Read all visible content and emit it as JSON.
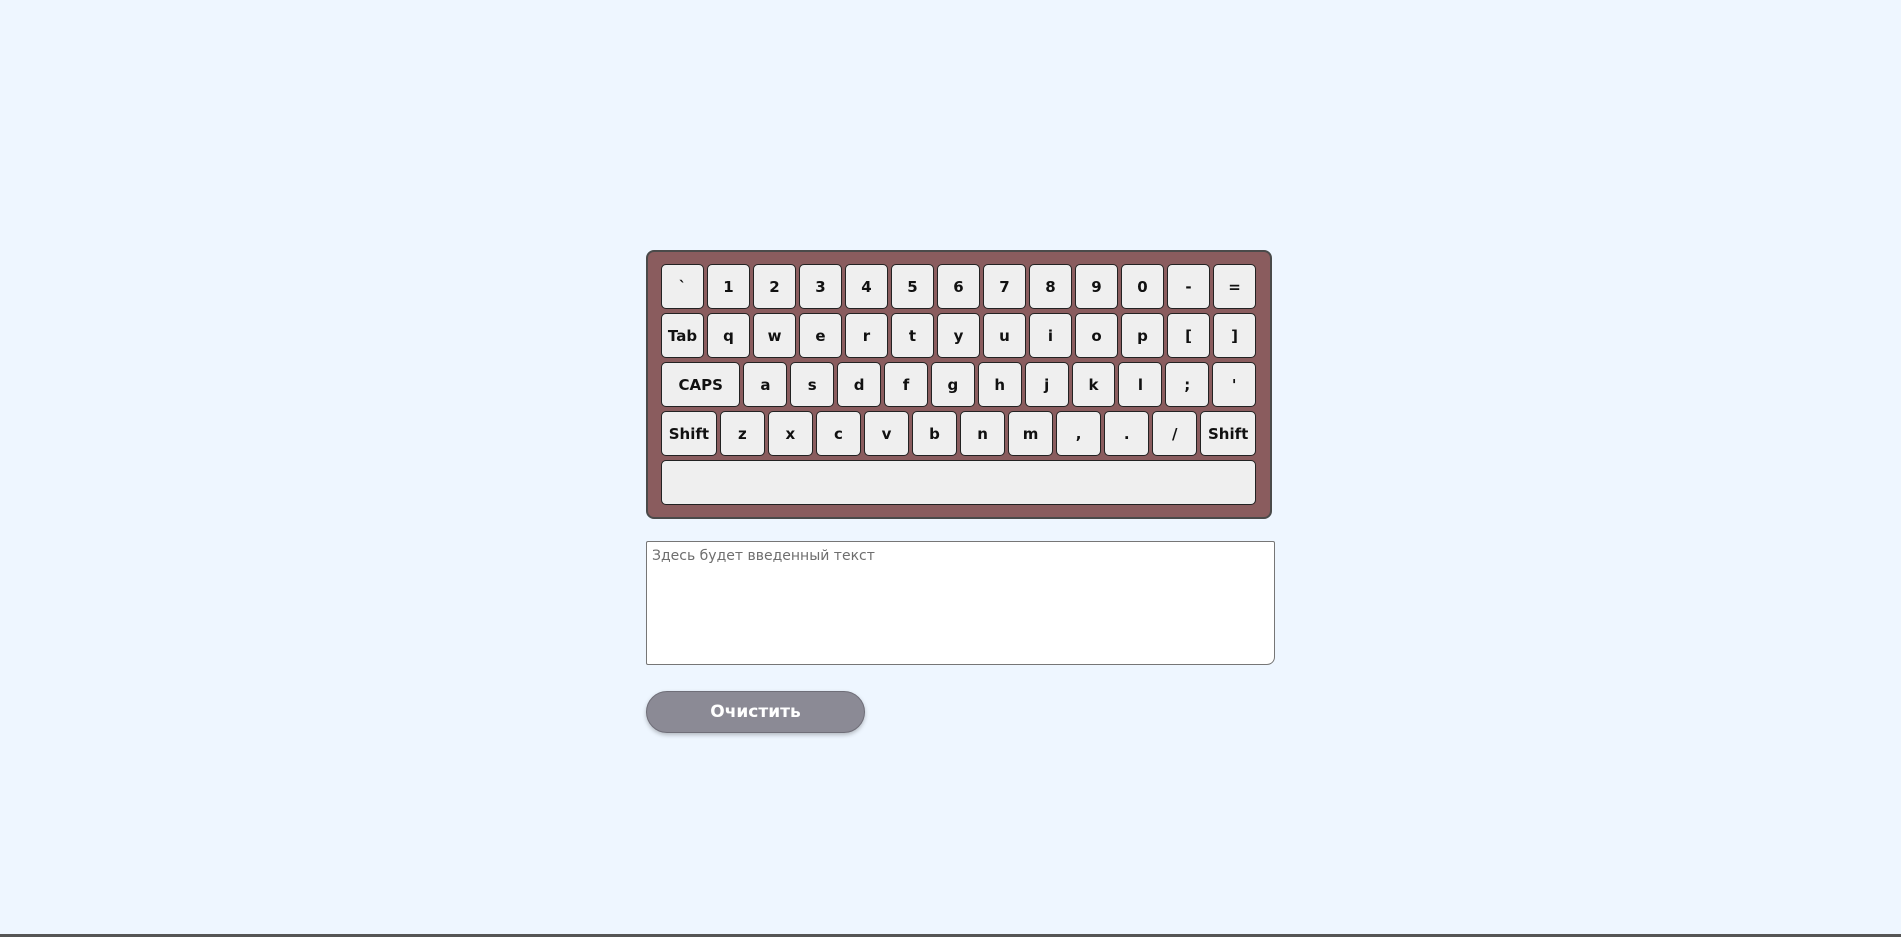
{
  "keyboard": {
    "rows": [
      [
        "`",
        "1",
        "2",
        "3",
        "4",
        "5",
        "6",
        "7",
        "8",
        "9",
        "0",
        "-",
        "="
      ],
      [
        "Tab",
        "q",
        "w",
        "e",
        "r",
        "t",
        "y",
        "u",
        "i",
        "o",
        "p",
        "[",
        "]"
      ],
      [
        "CAPS",
        "a",
        "s",
        "d",
        "f",
        "g",
        "h",
        "j",
        "k",
        "l",
        ";",
        "'"
      ],
      [
        "Shift",
        "z",
        "x",
        "c",
        "v",
        "b",
        "n",
        "m",
        ",",
        ".",
        "/",
        "Shift"
      ],
      [
        ""
      ]
    ]
  },
  "output": {
    "placeholder": "Здесь будет введенный текст",
    "value": ""
  },
  "clear_button": {
    "label": "Очистить"
  },
  "colors": {
    "background": "#eef6ff",
    "keyboard_body": "#8a5c5e",
    "key": "#efefef",
    "button": "#8b8a95"
  }
}
